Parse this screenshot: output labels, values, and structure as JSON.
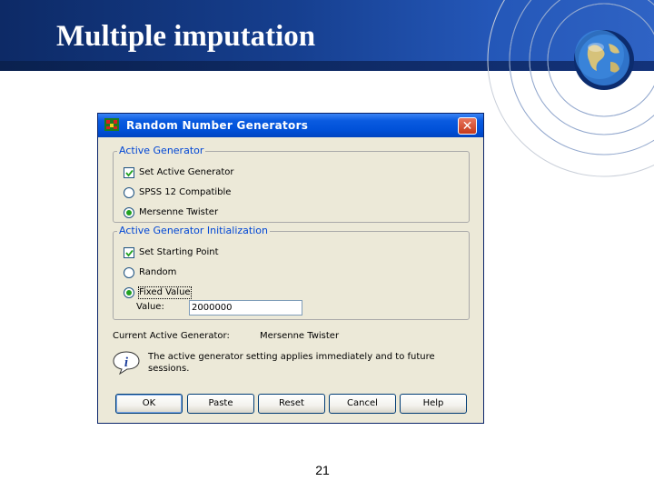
{
  "slide": {
    "title": "Multiple imputation",
    "page_number": "21",
    "colors": {
      "header_blue": "#163f8f",
      "title_text": "#ffffff"
    },
    "decoration": [
      "globe-icon"
    ]
  },
  "dialog": {
    "title": "Random Number Generators",
    "close_glyph": "✕",
    "active_generator": {
      "legend": "Active Generator",
      "set_active": {
        "label": "Set Active Generator",
        "checked": true
      },
      "options": [
        {
          "label": "SPSS 12 Compatible",
          "selected": false
        },
        {
          "label": "Mersenne Twister",
          "selected": true
        }
      ]
    },
    "initialization": {
      "legend": "Active Generator Initialization",
      "set_starting_point": {
        "label": "Set Starting Point",
        "checked": true
      },
      "options": [
        {
          "label": "Random",
          "selected": false
        },
        {
          "label": "Fixed Value",
          "selected": true
        }
      ],
      "value_label": "Value:",
      "value": "2000000"
    },
    "current": {
      "label": "Current Active Generator:",
      "value": "Mersenne Twister"
    },
    "info_text": "The active generator setting applies immediately and to future sessions.",
    "buttons": {
      "ok": "OK",
      "paste": "Paste",
      "reset": "Reset",
      "cancel": "Cancel",
      "help": "Help"
    }
  }
}
